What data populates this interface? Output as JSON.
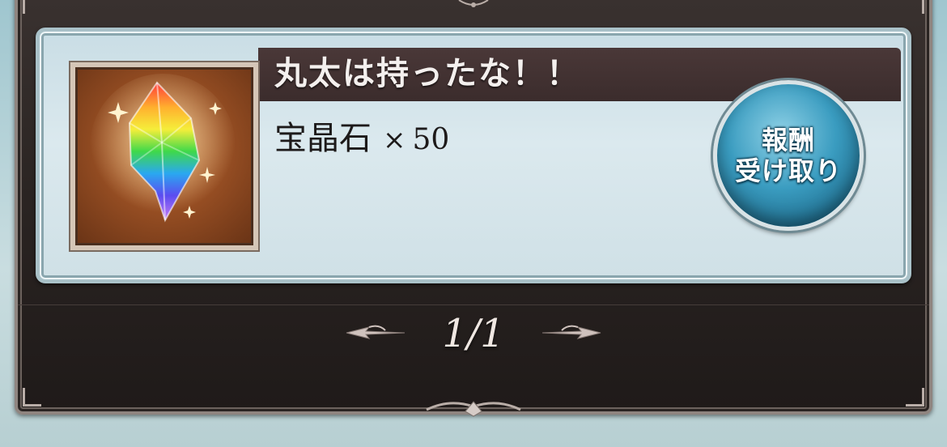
{
  "reward": {
    "title": "丸太は持ったな！！",
    "item_name": "宝晶石",
    "times_symbol": "×",
    "quantity": "50",
    "item_icon": "rainbow-crystal-icon"
  },
  "claim_button": {
    "line1": "報酬",
    "line2": "受け取り"
  },
  "pagination": {
    "indicator": "1/1",
    "prev_icon": "arrow-left-icon",
    "next_icon": "arrow-right-icon"
  },
  "colors": {
    "title_bar": "#3b2c2c",
    "card_bg": "#dbe9ee",
    "button_blue": "#3a9cc0",
    "frame_dark": "#2a2422"
  }
}
